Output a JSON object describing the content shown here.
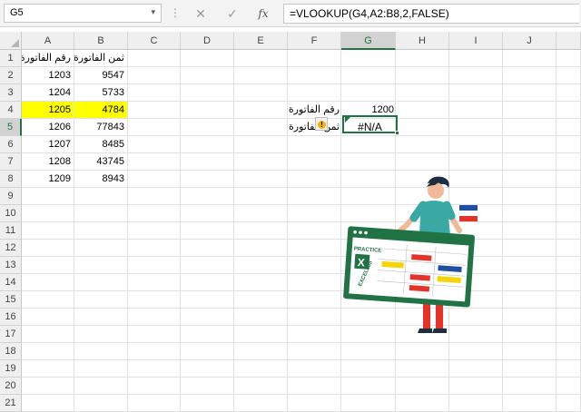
{
  "name_box": "G5",
  "formula": "=VLOOKUP(G4,A2:B8,2,FALSE)",
  "icons": {
    "namebox_dropdown": "chevron-down-icon",
    "cancel": "close-icon",
    "enter": "check-icon",
    "function": "fx-icon",
    "error_warning": "warning-icon"
  },
  "formula_buttons": {
    "cancel": "✕",
    "enter": "✓",
    "fx": "fx"
  },
  "columns": [
    "A",
    "B",
    "C",
    "D",
    "E",
    "F",
    "G",
    "H",
    "I",
    "J"
  ],
  "active_column": "G",
  "rows": [
    "1",
    "2",
    "3",
    "4",
    "5",
    "6",
    "7",
    "8",
    "9",
    "10",
    "11",
    "12",
    "13",
    "14",
    "15",
    "16",
    "17",
    "18",
    "19",
    "20",
    "21"
  ],
  "active_row": "5",
  "table": {
    "headers": {
      "a": "رقم الفاتورة",
      "b": "ثمن الفاتورة"
    },
    "rows": [
      {
        "a": "1203",
        "b": "9547"
      },
      {
        "a": "1204",
        "b": "5733"
      },
      {
        "a": "1205",
        "b": "4784"
      },
      {
        "a": "1206",
        "b": "77843"
      },
      {
        "a": "1207",
        "b": "8485"
      },
      {
        "a": "1208",
        "b": "43745"
      },
      {
        "a": "1209",
        "b": "8943"
      }
    ]
  },
  "lookup": {
    "f4_label": "رقم الفاتورة",
    "g4_value": "1200",
    "f5_label": "ثمن الفاتورة",
    "g5_value": "#N/A"
  },
  "illustration": {
    "logo_line1": "PRACTICE",
    "logo_line2": "EXCEL365",
    "logo_letter": "X"
  },
  "colors": {
    "highlight": "#FFFF00",
    "excel_green": "#217346",
    "accent_blue": "#1F4FA3",
    "accent_red": "#E5332A",
    "accent_yellow": "#F5D400"
  }
}
